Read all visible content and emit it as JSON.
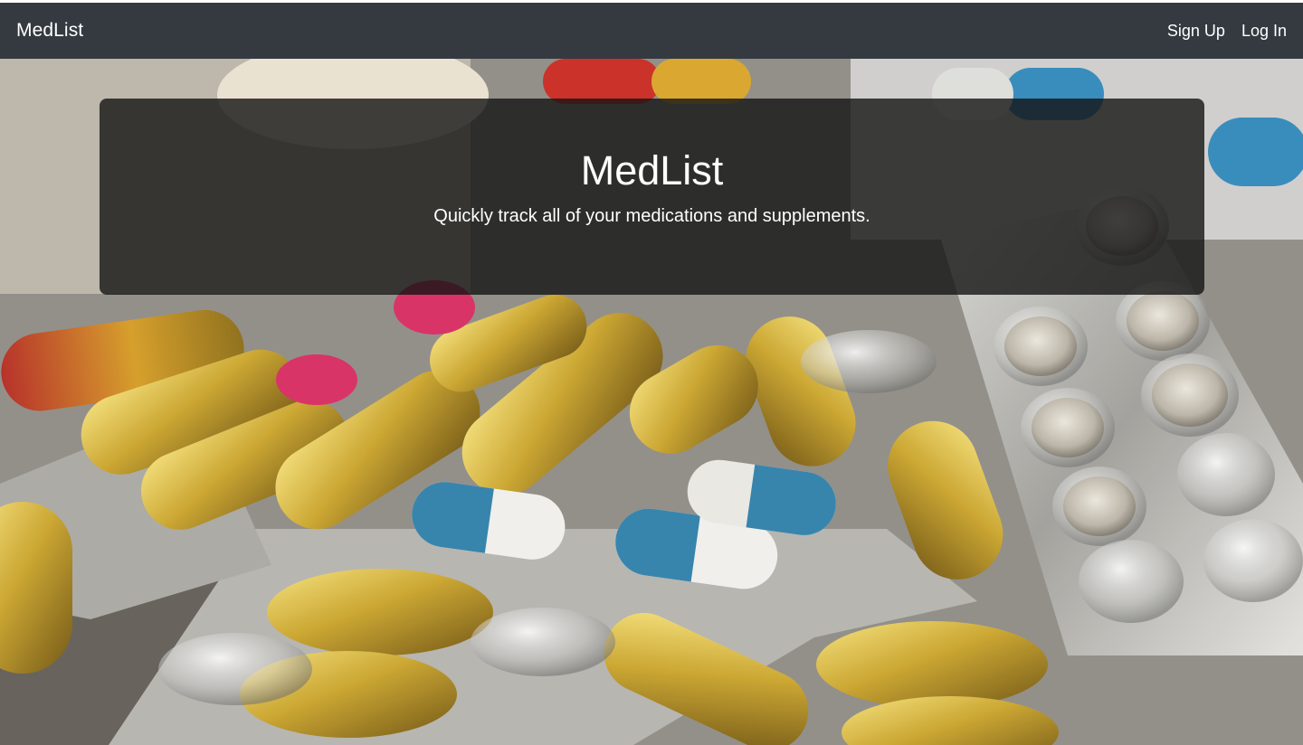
{
  "navbar": {
    "brand": "MedList",
    "links": [
      {
        "label": "Sign Up"
      },
      {
        "label": "Log In"
      }
    ]
  },
  "hero": {
    "title": "MedList",
    "subtitle": "Quickly track all of your medications and supplements.",
    "background_image": "pills-and-capsules-photo"
  },
  "colors": {
    "navbar_bg": "#343a40",
    "text": "#ffffff",
    "jumbotron_bg": "rgba(20,20,20,0.80)"
  }
}
